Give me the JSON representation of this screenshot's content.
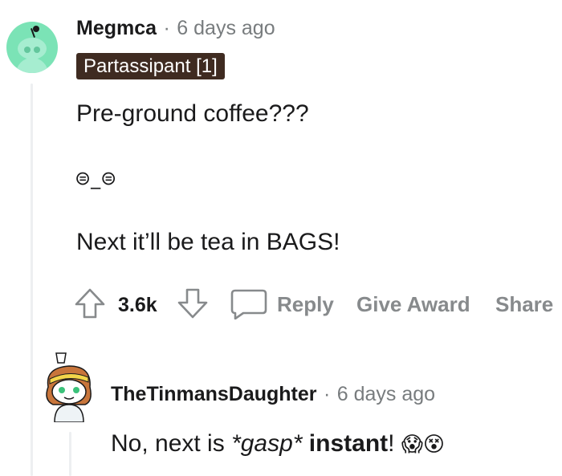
{
  "comment1": {
    "username": "Megmca",
    "separator": "·",
    "timestamp": "6 days ago",
    "flair": "Partassipant [1]",
    "lines": [
      "Pre-ground coffee???",
      "⊜_⊜",
      "Next it’ll be tea in BAGS!"
    ],
    "score": "3.6k",
    "actions": {
      "reply": "Reply",
      "give_award": "Give Award",
      "share": "Share"
    }
  },
  "comment2": {
    "username": "TheTinmansDaughter",
    "separator": "·",
    "timestamp": "6 days ago",
    "text_prefix": "No, next is ",
    "text_italic": "*gasp*",
    "text_bold": " instant",
    "text_suffix": "! ",
    "emojis": [
      "😱",
      "😵"
    ]
  },
  "colors": {
    "flair_bg": "#3f2b21",
    "avatar1_bg": "#7be3b6",
    "muted": "#878a8c",
    "thread_line": "#edeff1"
  }
}
